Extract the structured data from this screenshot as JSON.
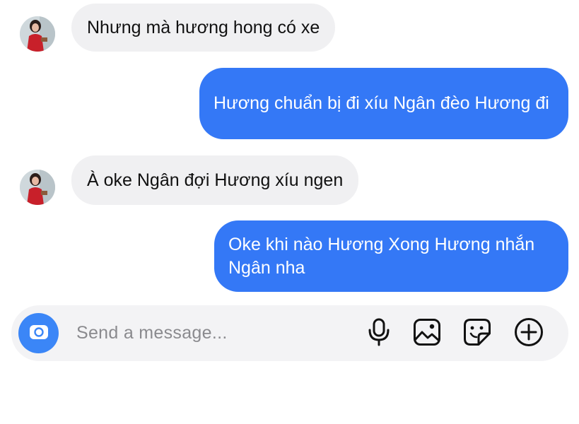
{
  "chat": {
    "messages": [
      {
        "sender": "them",
        "text": "Nhưng mà hương hong có xe"
      },
      {
        "sender": "me",
        "text": "Hương chuẩn bị đi xíu Ngân đèo Hương đi"
      },
      {
        "sender": "them",
        "text": "À oke Ngân đợi Hương xíu ngen"
      },
      {
        "sender": "me",
        "line1": "Oke khi nào Hương Xong Hương nhắn",
        "line2": "Ngân nha"
      }
    ]
  },
  "composer": {
    "placeholder": "Send a message...",
    "icons": [
      "camera-icon",
      "microphone-icon",
      "gallery-icon",
      "sticker-icon",
      "plus-circle-icon"
    ]
  },
  "colors": {
    "outgoing_bubble": "#3478f6",
    "incoming_bubble": "#f0f0f2",
    "camera_button": "#3b86f7",
    "composer_background": "#f3f3f5"
  }
}
